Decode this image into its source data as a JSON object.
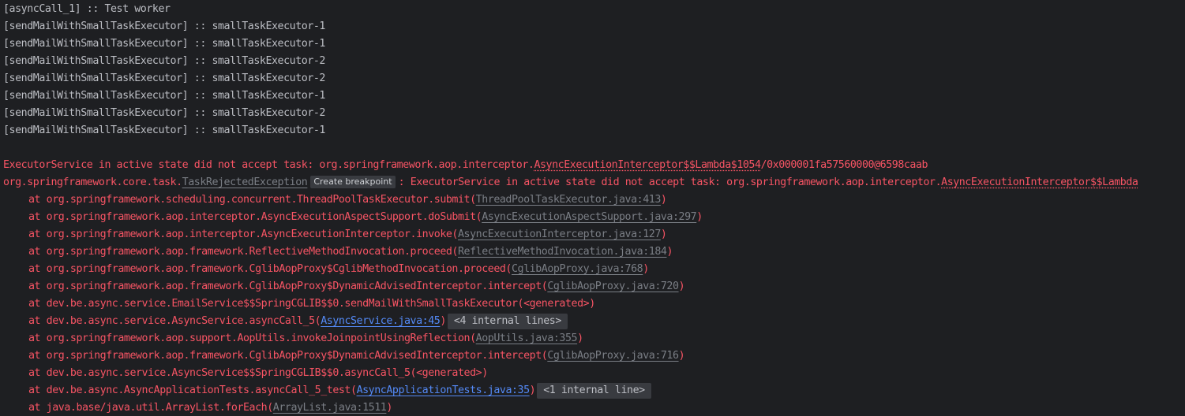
{
  "console": {
    "output": [
      "[asyncCall_1] :: Test worker",
      "[sendMailWithSmallTaskExecutor] :: smallTaskExecutor-1",
      "[sendMailWithSmallTaskExecutor] :: smallTaskExecutor-1",
      "[sendMailWithSmallTaskExecutor] :: smallTaskExecutor-2",
      "[sendMailWithSmallTaskExecutor] :: smallTaskExecutor-2",
      "[sendMailWithSmallTaskExecutor] :: smallTaskExecutor-1",
      "[sendMailWithSmallTaskExecutor] :: smallTaskExecutor-2",
      "[sendMailWithSmallTaskExecutor] :: smallTaskExecutor-1"
    ],
    "error_message": {
      "prefix": "ExecutorService in active state did not accept task: org.springframework.aop.interceptor.",
      "class_link": "AsyncExecutionInterceptor$$Lambda$1054",
      "suffix": "/0x000001fa57560000@6598caab"
    },
    "exception_line": {
      "package": "org.springframework.core.task.",
      "exception_class": "TaskRejectedException",
      "tooltip": "Create breakpoint",
      "message": ": ExecutorService in active state did not accept task: org.springframework.aop.interceptor.",
      "class_link": "AsyncExecutionInterceptor$$Lambda"
    },
    "stack_frames": [
      {
        "method": "at org.springframework.scheduling.concurrent.ThreadPoolTaskExecutor.submit(",
        "source": "ThreadPoolTaskExecutor.java:413",
        "user_code": false,
        "close": ")",
        "fold": ""
      },
      {
        "method": "at org.springframework.aop.interceptor.AsyncExecutionAspectSupport.doSubmit(",
        "source": "AsyncExecutionAspectSupport.java:297",
        "user_code": false,
        "close": ")",
        "fold": ""
      },
      {
        "method": "at org.springframework.aop.interceptor.AsyncExecutionInterceptor.invoke(",
        "source": "AsyncExecutionInterceptor.java:127",
        "user_code": false,
        "close": ")",
        "fold": ""
      },
      {
        "method": "at org.springframework.aop.framework.ReflectiveMethodInvocation.proceed(",
        "source": "ReflectiveMethodInvocation.java:184",
        "user_code": false,
        "close": ")",
        "fold": ""
      },
      {
        "method": "at org.springframework.aop.framework.CglibAopProxy$CglibMethodInvocation.proceed(",
        "source": "CglibAopProxy.java:768",
        "user_code": false,
        "close": ")",
        "fold": ""
      },
      {
        "method": "at org.springframework.aop.framework.CglibAopProxy$DynamicAdvisedInterceptor.intercept(",
        "source": "CglibAopProxy.java:720",
        "user_code": false,
        "close": ")",
        "fold": ""
      },
      {
        "method": "at dev.be.async.service.EmailService$$SpringCGLIB$$0.sendMailWithSmallTaskExecutor(<generated>)",
        "source": "",
        "user_code": false,
        "close": "",
        "fold": ""
      },
      {
        "method": "at dev.be.async.service.AsyncService.asyncCall_5(",
        "source": "AsyncService.java:45",
        "user_code": true,
        "close": ")",
        "fold": "<4 internal lines>"
      },
      {
        "method": "at org.springframework.aop.support.AopUtils.invokeJoinpointUsingReflection(",
        "source": "AopUtils.java:355",
        "user_code": false,
        "close": ")",
        "fold": ""
      },
      {
        "method": "at org.springframework.aop.framework.CglibAopProxy$DynamicAdvisedInterceptor.intercept(",
        "source": "CglibAopProxy.java:716",
        "user_code": false,
        "close": ")",
        "fold": ""
      },
      {
        "method": "at dev.be.async.service.AsyncService$$SpringCGLIB$$0.asyncCall_5(<generated>)",
        "source": "",
        "user_code": false,
        "close": "",
        "fold": ""
      },
      {
        "method": "at dev.be.async.AsyncApplicationTests.asyncCall_5_test(",
        "source": "AsyncApplicationTests.java:35",
        "user_code": true,
        "close": ")",
        "fold": "<1 internal line>"
      },
      {
        "method": "at java.base/java.util.ArrayList.forEach(",
        "source": "ArrayList.java:1511",
        "user_code": false,
        "close": ")",
        "fold": ""
      }
    ]
  },
  "colors": {
    "background": "#1e1f22",
    "stdout": "#bcbec4",
    "stderr": "#f75464",
    "library_link": "#7a7e85",
    "user_link": "#548af7",
    "fold_background": "#393b40"
  }
}
